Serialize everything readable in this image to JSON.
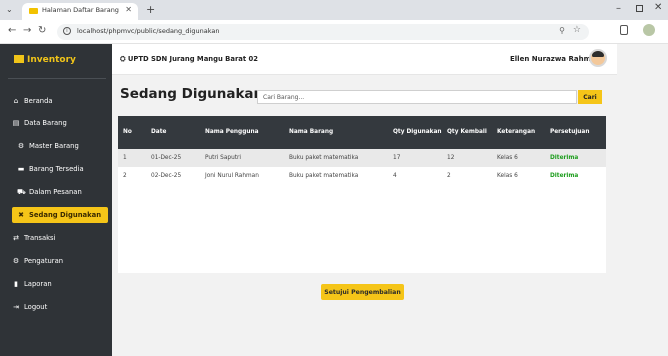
{
  "browser": {
    "tab_title": "Halaman Daftar Barang",
    "url": "localhost/phpmvc/public/sedang_digunakan"
  },
  "sidebar": {
    "brand": "Inventory",
    "items": [
      {
        "label": "Beranda",
        "icon": "home-icon"
      },
      {
        "label": "Data Barang",
        "icon": "folder-icon"
      },
      {
        "label": "Master Barang",
        "icon": "gear-icon"
      },
      {
        "label": "Barang Tersedia",
        "icon": "boxes-icon"
      },
      {
        "label": "Dalam Pesanan",
        "icon": "cart-icon"
      },
      {
        "label": "Sedang Digunakan",
        "icon": "tools-icon",
        "active": true
      },
      {
        "label": "Transaksi",
        "icon": "exchange-icon"
      },
      {
        "label": "Pengaturan",
        "icon": "gears-icon"
      },
      {
        "label": "Laporan",
        "icon": "file-icon"
      },
      {
        "label": "Logout",
        "icon": "logout-icon"
      }
    ]
  },
  "header": {
    "school": "UPTD SDN Jurang Mangu Barat 02",
    "user": "Ellen Nurazwa Rahman"
  },
  "main": {
    "title": "Sedang Digunakan",
    "search_placeholder": "Cari Barang...",
    "search_button": "Cari",
    "approve_button": "Setujui Pengembalian"
  },
  "table": {
    "headers": [
      "No",
      "Date",
      "Nama Pengguna",
      "Nama Barang",
      "Qty Digunakan",
      "Qty Kembali",
      "Keterangan",
      "Persetujuan"
    ],
    "rows": [
      [
        "1",
        "01-Dec-25",
        "Putri Saputri",
        "Buku paket matematika",
        "17",
        "12",
        "Kelas 6",
        "Diterima"
      ],
      [
        "2",
        "02-Dec-25",
        "Joni Nurul Rahman",
        "Buku paket matematika",
        "4",
        "2",
        "Kelas 6",
        "Diterima"
      ]
    ]
  },
  "colors": {
    "accent": "#f5c518",
    "sidebar_bg": "#2f3337",
    "table_header_bg": "#34393e",
    "status_accepted": "#1f9e1f"
  }
}
